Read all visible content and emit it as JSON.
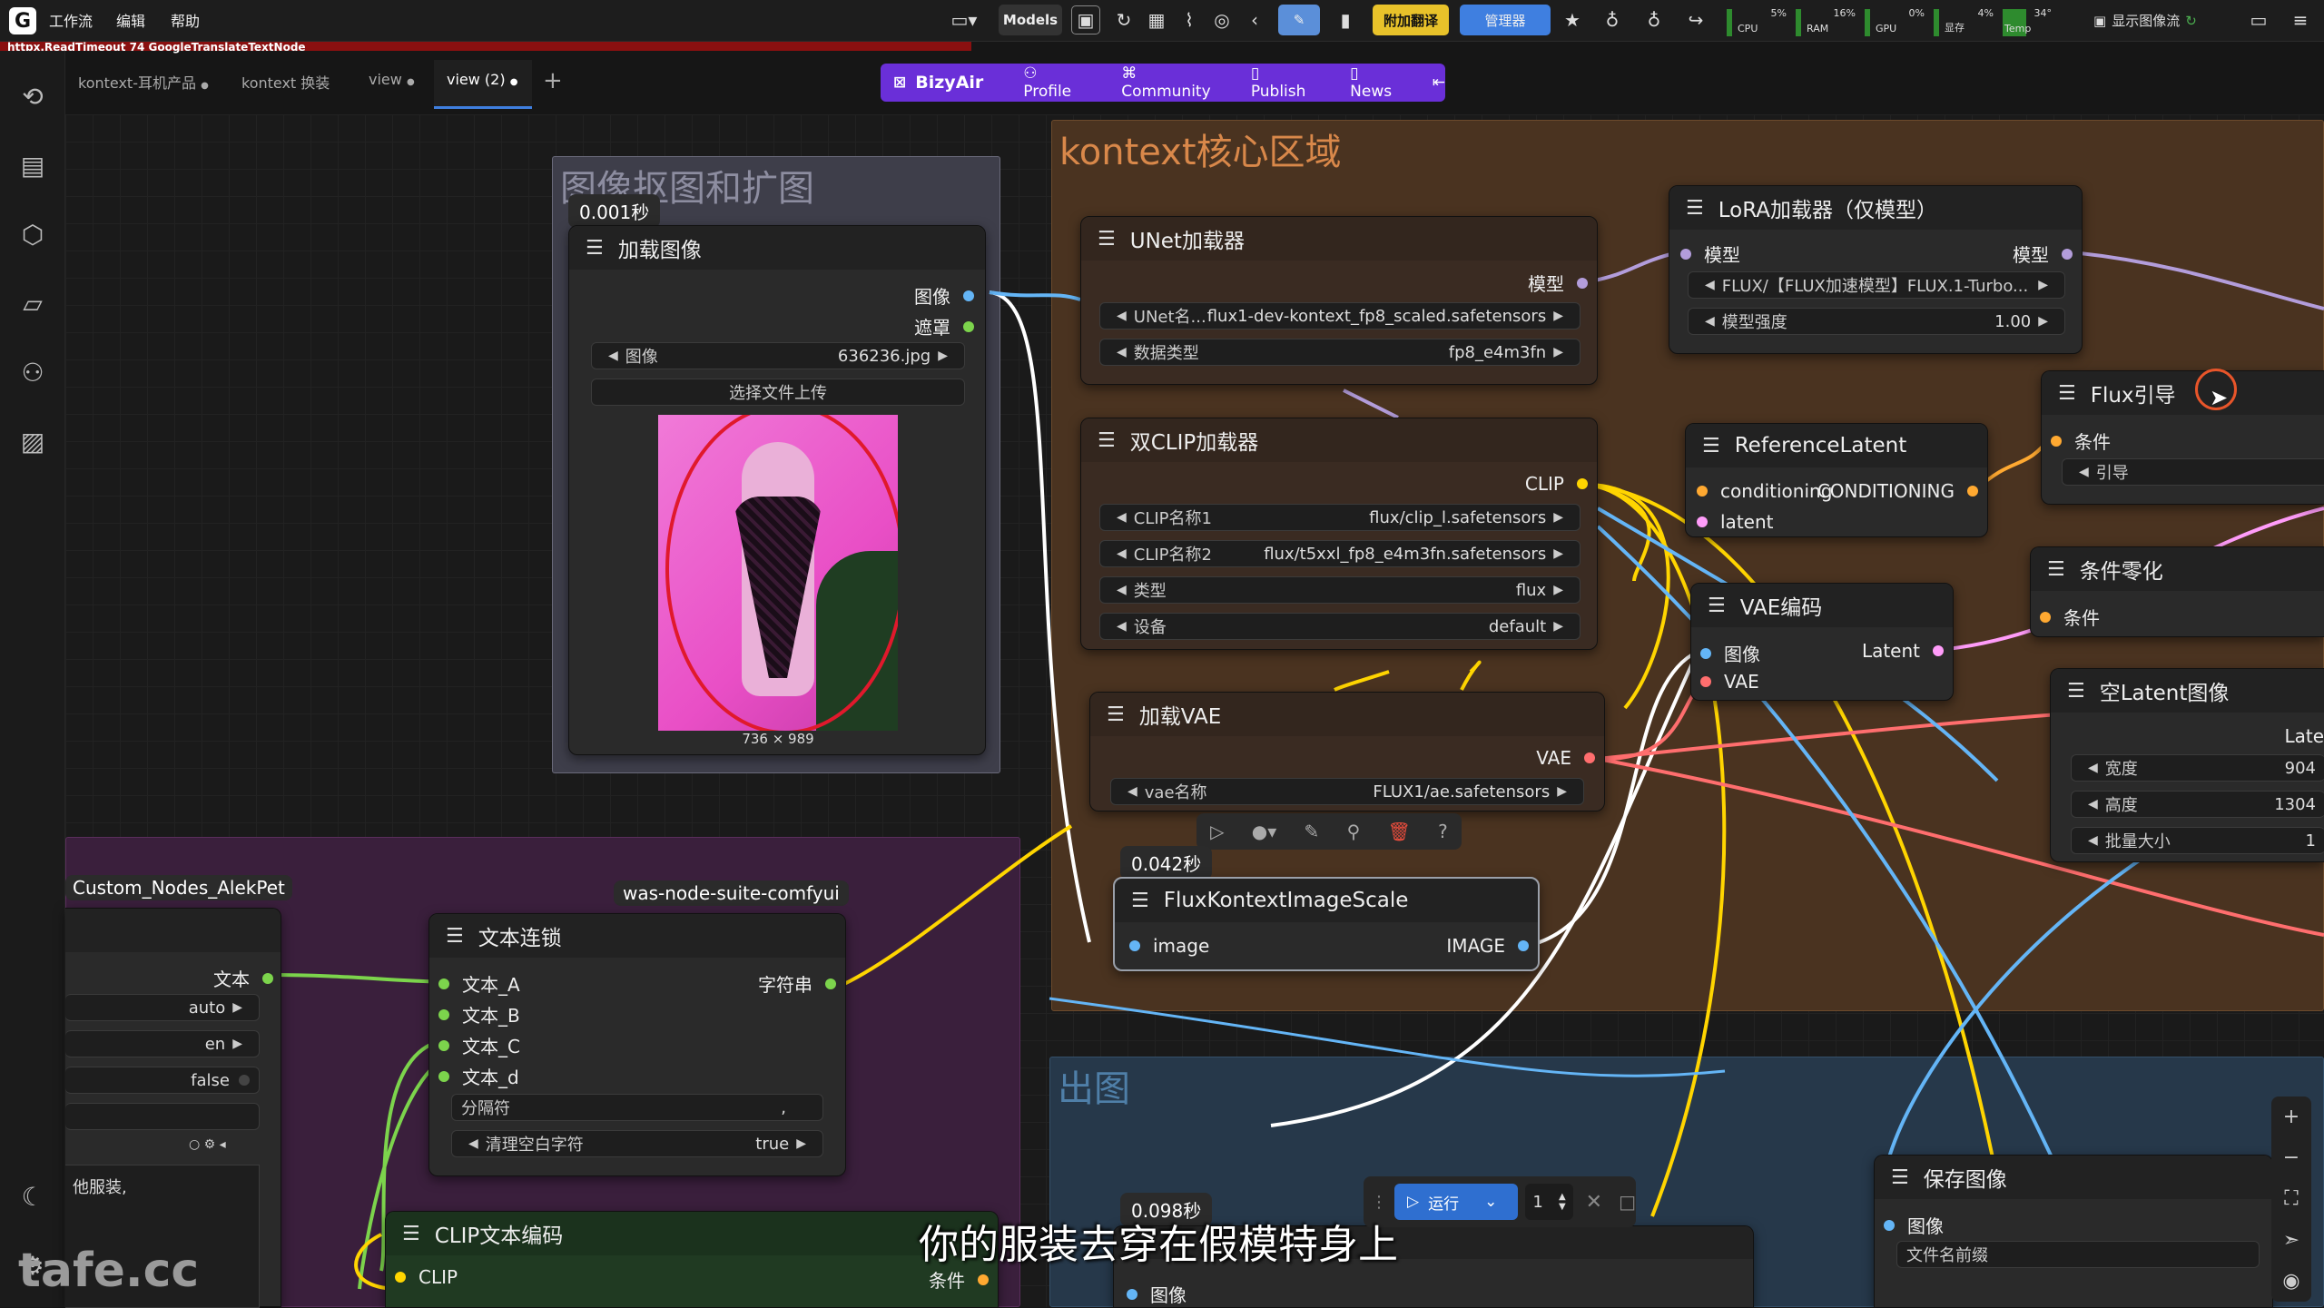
{
  "menu": {
    "logo": "G",
    "items": [
      "工作流",
      "编辑",
      "帮助"
    ]
  },
  "toolbar": {
    "models_label": "Models",
    "plugin_translate": "附加翻译",
    "manager": "管理器",
    "show_image_stream": "显示图像流",
    "stats": [
      {
        "label": "CPU",
        "value": "5%"
      },
      {
        "label": "RAM",
        "value": "16%"
      },
      {
        "label": "GPU",
        "value": "0%"
      },
      {
        "label": "显存",
        "value": "4%"
      },
      {
        "label": "Temp",
        "value": "34°"
      }
    ]
  },
  "error_text": "httpx.ReadTimeout 74 GoogleTranslateTextNode",
  "tabs": [
    {
      "label": "kontext-耳机产品",
      "dot": "●"
    },
    {
      "label": "kontext 换装",
      "dot": ""
    },
    {
      "label": "view",
      "dot": "●"
    },
    {
      "label": "view (2)",
      "dot": "●"
    }
  ],
  "tab_add": "+",
  "bizyair": {
    "brand": "BizyAir",
    "items": [
      "Profile",
      "Community",
      "Publish",
      "News"
    ]
  },
  "groups": {
    "g1": "图像抠图和扩图",
    "g2": "kontext核心区域",
    "g3": "出图"
  },
  "timings": {
    "t1": "0.001秒",
    "t2": "0.042秒",
    "t3": "0.098秒"
  },
  "nodes": {
    "load_image": {
      "title": "加载图像",
      "out_image": "图像",
      "out_mask": "遮罩",
      "w_image_label": "图像",
      "w_image_value": "636236.jpg",
      "upload": "选择文件上传",
      "dims": "736 × 989"
    },
    "unet": {
      "title": "UNet加载器",
      "out_model": "模型",
      "w1_label": "UNet名...",
      "w1_value": "flux1-dev-kontext_fp8_scaled.safetensors",
      "w2_label": "数据类型",
      "w2_value": "fp8_e4m3fn"
    },
    "dualclip": {
      "title": "双CLIP加载器",
      "out_clip": "CLIP",
      "w1_label": "CLIP名称1",
      "w1_value": "flux/clip_l.safetensors",
      "w2_label": "CLIP名称2",
      "w2_value": "flux/t5xxl_fp8_e4m3fn.safetensors",
      "w3_label": "类型",
      "w3_value": "flux",
      "w4_label": "设备",
      "w4_value": "default"
    },
    "vae": {
      "title": "加载VAE",
      "out_vae": "VAE",
      "w1_label": "vae名称",
      "w1_value": "FLUX1/ae.safetensors"
    },
    "fkis": {
      "title": "FluxKontextImageScale",
      "in_image": "image",
      "out_image": "IMAGE"
    },
    "lora": {
      "title": "LoRA加载器（仅模型）",
      "in_model": "模型",
      "out_model": "模型",
      "w1_value": "FLUX/【FLUX加速模型】FLUX.1-Turbo...",
      "w2_label": "模型强度",
      "w2_value": "1.00"
    },
    "reflatent": {
      "title": "ReferenceLatent",
      "in1": "conditioning",
      "out1": "CONDITIONING",
      "in2": "latent"
    },
    "vaeenc": {
      "title": "VAE编码",
      "in1": "图像",
      "in2": "VAE",
      "out1": "Latent"
    },
    "fluxguide": {
      "title": "Flux引导",
      "in1": "条件",
      "w1_label": "引导"
    },
    "condzero": {
      "title": "条件零化",
      "in1": "条件"
    },
    "emptylatent": {
      "title": "空Latent图像",
      "out1": "Late",
      "w1_label": "宽度",
      "w1_value": "904",
      "w2_label": "高度",
      "w2_value": "1304",
      "w3_label": "批量大小",
      "w3_value": "1"
    },
    "alekpet": {
      "badge": "Custom_Nodes_AlekPet",
      "out1": "文本",
      "w1": "auto",
      "w2": "en",
      "w3": "false",
      "text": "他服装,"
    },
    "textconcat": {
      "badge": "was-node-suite-comfyui",
      "title": "文本连锁",
      "in_a": "文本_A",
      "in_b": "文本_B",
      "in_c": "文本_C",
      "in_d": "文本_d",
      "out1": "字符串",
      "w1_label": "分隔符",
      "w1_value": ",",
      "w2_label": "清理空白字符",
      "w2_value": "true"
    },
    "clipenc": {
      "title": "CLIP文本编码",
      "in1": "CLIP",
      "out1": "条件"
    },
    "saveimage": {
      "title": "保存图像",
      "in1": "图像",
      "w1_label": "文件名前缀"
    },
    "bottom_node": {
      "in1": "图像"
    }
  },
  "runbar": {
    "run": "运行",
    "count": "1"
  },
  "subtitle": "你的服装去穿在假模特身上",
  "watermark": "tafe.cc",
  "colors": {
    "model": "#b39ddb",
    "clip": "#ffd500",
    "vae": "#ff6e6e",
    "image": "#64b5f6",
    "latent": "#ff9cf9",
    "conditioning": "#ffa931",
    "string": "#7cd44c",
    "bizyair": "#6a2fd8"
  }
}
